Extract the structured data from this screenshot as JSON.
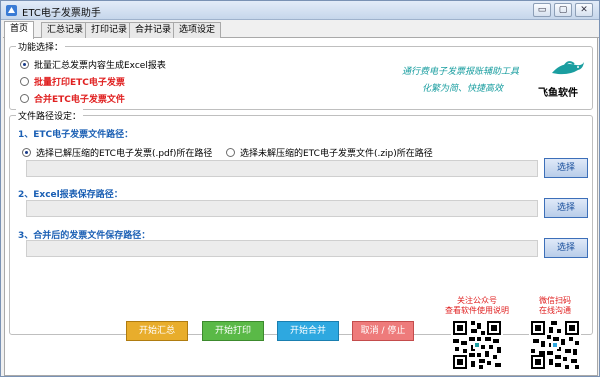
{
  "window": {
    "title": "ETC电子发票助手",
    "min_label": "▭",
    "max_label": "▢",
    "close_label": "✕"
  },
  "tabs": [
    {
      "label": "首页"
    },
    {
      "label": "汇总记录"
    },
    {
      "label": "打印记录"
    },
    {
      "label": "合并记录"
    },
    {
      "label": "选项设定"
    }
  ],
  "function_group": {
    "legend": "功能选择：",
    "options": [
      {
        "label": "批量汇总发票内容生成Excel报表",
        "selected": true,
        "red": false
      },
      {
        "label": "批量打印ETC电子发票",
        "selected": false,
        "red": true
      },
      {
        "label": "合并ETC电子发票文件",
        "selected": false,
        "red": true
      }
    ],
    "slogan_line1": "通行费电子发票报账辅助工具",
    "slogan_line2": "化繁为简、快捷高效",
    "logo_text": "飞鱼软件"
  },
  "path_group": {
    "legend": "文件路径设定：",
    "section1_title": "1、ETC电子发票文件路径：",
    "radio_pdf": "选择已解压缩的ETC电子发票(.pdf)所在路径",
    "radio_zip": "选择未解压缩的ETC电子发票文件(.zip)所在路径",
    "section2_title": "2、Excel报表保存路径：",
    "section3_title": "3、合并后的发票文件保存路径：",
    "path1_value": "",
    "path2_value": "",
    "path3_value": "",
    "browse_label": "选择"
  },
  "actions": {
    "summary": "开始汇总",
    "print": "开始打印",
    "merge": "开始合并",
    "cancel": "取消 / 停止"
  },
  "qr_left": {
    "line1": "关注公众号",
    "line2": "查看软件使用说明"
  },
  "qr_right": {
    "line1": "微信扫码",
    "line2": "在线沟通"
  },
  "colors": {
    "accent_blue": "#1a5fb4",
    "red": "#e02020",
    "slogan": "#1a9ea0"
  }
}
